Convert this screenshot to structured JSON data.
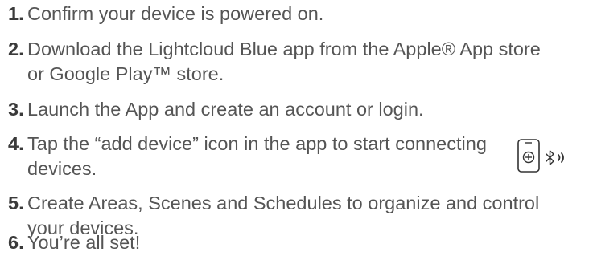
{
  "steps": [
    {
      "number": "1.",
      "lines": [
        "Confirm your device is powered on."
      ]
    },
    {
      "number": "2.",
      "lines": [
        "Download the Lightcloud Blue app from the Apple® App store",
        "or Google Play™ store."
      ]
    },
    {
      "number": "3.",
      "lines": [
        "Launch the App and create an account or login."
      ]
    },
    {
      "number": "4.",
      "lines": [
        "Tap the “add device” icon in the app to start connecting",
        "devices."
      ]
    },
    {
      "number": "5.",
      "lines": [
        "Create Areas, Scenes and Schedules to organize and control",
        "your devices."
      ]
    },
    {
      "number": "6.",
      "lines": [
        "You’re all set!"
      ]
    }
  ],
  "icons": {
    "add_device": "add-device-icon",
    "bluetooth": "bluetooth-icon",
    "signal": "signal-waves-icon"
  },
  "colors": {
    "text": "#555555",
    "number": "#3a3a3a"
  }
}
